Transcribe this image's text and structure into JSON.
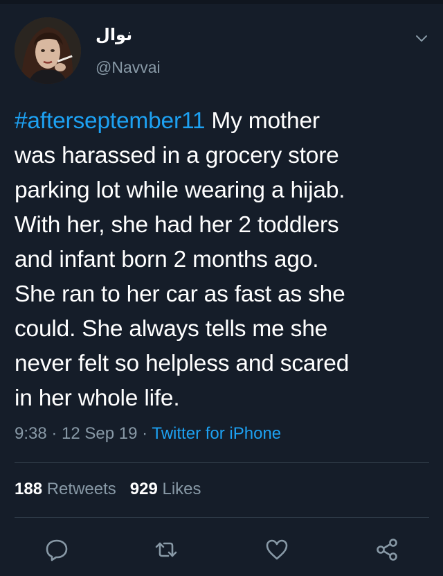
{
  "user": {
    "display_name": "نوال",
    "handle": "@Navvai"
  },
  "tweet": {
    "hashtag": "#afterseptember11",
    "lines": [
      " My mother",
      "was harassed in a grocery store",
      "parking lot while wearing a hijab.",
      "With her, she had her 2 toddlers",
      "and infant born 2 months ago.",
      "She ran to her car as fast as she",
      "could. She always tells me she",
      "never felt so helpless and scared",
      "in her whole life."
    ]
  },
  "meta": {
    "time": "9:38",
    "sep1": " · ",
    "date": "12 Sep 19",
    "sep2": " · ",
    "source": "Twitter for iPhone"
  },
  "stats": {
    "retweets_count": "188",
    "retweets_label": "Retweets",
    "likes_count": "929",
    "likes_label": "Likes"
  },
  "actions": [
    "reply-icon",
    "retweet-icon",
    "like-icon",
    "share-icon"
  ],
  "colors": {
    "background": "#151d29",
    "accent": "#1da1f2",
    "muted": "#8899a6",
    "divider": "#2f3b48"
  }
}
